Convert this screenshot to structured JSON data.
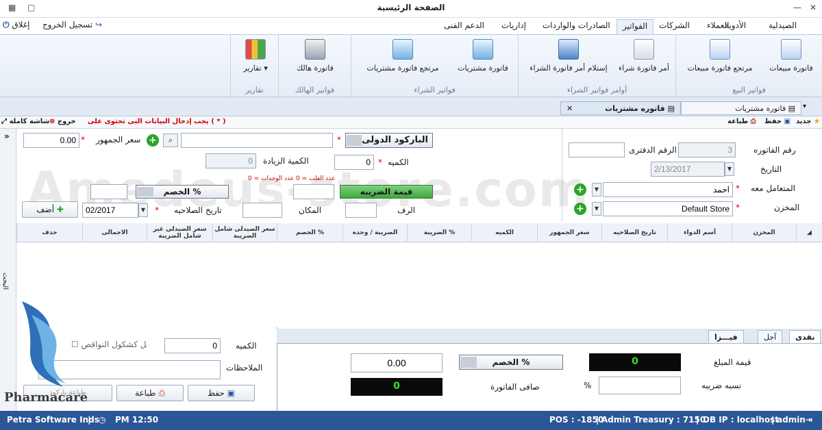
{
  "window": {
    "title": "الصفحة الرئيسية"
  },
  "ribbon_tabs": [
    "الصيدلية",
    "الأدوية",
    "العملاء",
    "الشركات",
    "الفواتير",
    "الصادرات والواردات",
    "إداريات",
    "الدعم الفنى"
  ],
  "active_tab": "الفواتير",
  "logout": {
    "signout": "تسجيل الخروج",
    "close": "إغلاق"
  },
  "ribbon_groups": {
    "sales": {
      "label": "فواتير البيع",
      "buttons": [
        "فاتورة مبيعات",
        "مرتجع فاتورة مبيعات"
      ]
    },
    "purchase_orders": {
      "label": "أوامر فواتير الشراء",
      "buttons": [
        "أمر فاتورة شراء",
        "إستلام أمر فاتورة الشراء"
      ]
    },
    "purchases": {
      "label": "فواتير الشراء",
      "buttons": [
        "فاتورة مشتريات",
        "مرتجع فاتورة مشتريات"
      ]
    },
    "damaged": {
      "label": "فواتير الهالك",
      "buttons": [
        "فاتورة هالك"
      ]
    },
    "reports": {
      "label": "تقارير",
      "buttons": [
        "تقارير"
      ]
    }
  },
  "doc_tabs": [
    "فاتوره مشتريات",
    "فاتوره مشتريات"
  ],
  "toolbar": {
    "new": "جديد",
    "save": "حفظ",
    "print": "طباعة",
    "required_note": "يجب إدخال البيانات التى تحتوى على ( * )",
    "exit": "خروج",
    "fullscreen": "شاشة كاملة"
  },
  "invoice": {
    "number_label": "رقم الفاتوره",
    "number": "3",
    "book_number_label": "الرقم الدفترى",
    "book_number": "",
    "date_label": "التاريخ",
    "date": "2/13/2017",
    "party_label": "المتعامل معه",
    "party": "احمد",
    "store_label": "المخزن",
    "store": "Default Store"
  },
  "item": {
    "barcode_label": "الباركود الدولى",
    "barcode": "",
    "public_price_label": "سعر الجمهور",
    "public_price": "0.00",
    "qty_label": "الكميه",
    "qty": "0",
    "extra_qty_label": "الكمية الزيادة",
    "extra_qty": "0",
    "units_note": "عدد العلب = 0   عدد الوحدات = 0",
    "tax_value_label": "قيمة الضريبه",
    "tax_value": "",
    "discount_label": "الخصم %",
    "discount": "",
    "shelf_label": "الرف",
    "shelf": "",
    "place_label": "المكان",
    "place": "",
    "expiry_label": "تاريخ الصلاحيه",
    "expiry": "02/2017",
    "add_label": "أضف"
  },
  "grid_columns": [
    "المخزن",
    "أسم الدواء",
    "تاريخ الصلاحيه",
    "سعر الجمهور",
    "الكميه",
    "الضريبة %",
    "الضريبة / وحده",
    "الخصم %",
    "سعر الصيدلى شامل الضريبة",
    "سعر الصيدلى غير شامل الضريبة",
    "الاجمالى",
    "حذف"
  ],
  "side_label": "البحث",
  "bottom_left": {
    "qty_label": "الكميه",
    "qty": "0",
    "ignore_label": "تجاهل كشكول النواقص",
    "notes_label": "الملاحظات",
    "notes": "",
    "save": "حفظ",
    "print": "طباعة",
    "print_barcode": "طباعة باركود"
  },
  "payment_tabs": [
    "نقدى",
    "آجل",
    "فيـــزا"
  ],
  "totals": {
    "amount_label": "قيمة المبلغ",
    "amount": "0",
    "discount_label": "الخصم %",
    "discount": "0.00",
    "tax_ratio_label": "نسبه ضريبه",
    "tax_ratio": "",
    "percent": "%",
    "net_label": "صافى الفاتورة",
    "net": "0"
  },
  "status": {
    "user": "admin",
    "db": "DB IP : localhost",
    "treasury": "Admin Treasury : 7150",
    "pos": "POS : -1850",
    "time": "PM 12:50",
    "company": "Petra Software Inds"
  },
  "watermark": "Amedeus-store.com",
  "logo_text": "Pharmacare",
  "colors": {
    "status_bar": "#2b5797",
    "green": "#2aa52a",
    "accent_red": "#d00000"
  }
}
